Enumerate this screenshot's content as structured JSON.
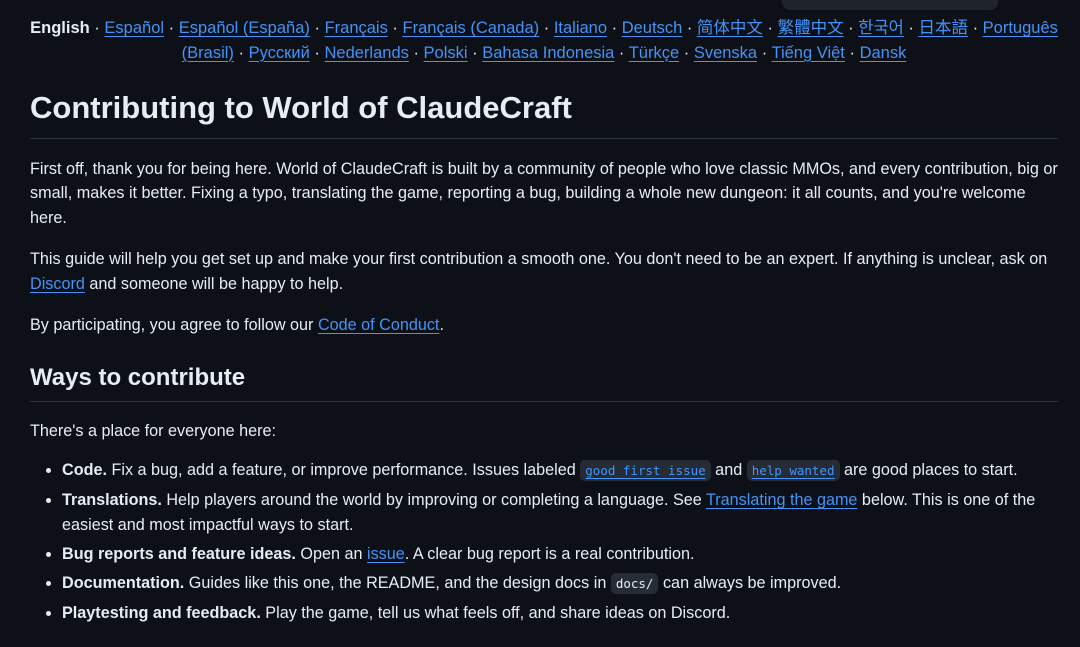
{
  "languages": {
    "current": "English",
    "links": [
      "Español",
      "Español (España)",
      "Français",
      "Français (Canada)",
      "Italiano",
      "Deutsch",
      "简体中文",
      "繁體中文",
      "한국어",
      "日本語",
      "Português (Brasil)",
      "Русский",
      "Nederlands",
      "Polski",
      "Bahasa Indonesia",
      "Türkçe",
      "Svenska",
      "Tiếng Việt",
      "Dansk"
    ],
    "separator": "·"
  },
  "title": "Contributing to World of ClaudeCraft",
  "intro": {
    "p1": "First off, thank you for being here. World of ClaudeCraft is built by a community of people who love classic MMOs, and every contribution, big or small, makes it better. Fixing a typo, translating the game, reporting a bug, building a whole new dungeon: it all counts, and you're welcome here.",
    "p2_before": "This guide will help you get set up and make your first contribution a smooth one. You don't need to be an expert. If anything is unclear, ask on ",
    "p2_link": "Discord",
    "p2_after": " and someone will be happy to help.",
    "p3_before": "By participating, you agree to follow our ",
    "p3_link": "Code of Conduct",
    "p3_after": "."
  },
  "ways": {
    "heading": "Ways to contribute",
    "lead": "There's a place for everyone here:",
    "items": {
      "code": {
        "label": "Code.",
        "text_before": " Fix a bug, add a feature, or improve performance. Issues labeled ",
        "tag1": "good first issue",
        "mid": " and ",
        "tag2": "help wanted",
        "text_after": " are good places to start."
      },
      "translations": {
        "label": "Translations.",
        "text_before": " Help players around the world by improving or completing a language. See ",
        "link": "Translating the game",
        "text_after": " below. This is one of the easiest and most impactful ways to start."
      },
      "bugs": {
        "label": "Bug reports and feature ideas.",
        "text_before": " Open an ",
        "link": "issue",
        "text_after": ". A clear bug report is a real contribution."
      },
      "docs": {
        "label": "Documentation.",
        "text_before": " Guides like this one, the README, and the design docs in ",
        "code": "docs/",
        "text_after": " can always be improved."
      },
      "playtesting": {
        "label": "Playtesting and feedback.",
        "text": " Play the game, tell us what feels off, and share ideas on Discord."
      }
    }
  }
}
